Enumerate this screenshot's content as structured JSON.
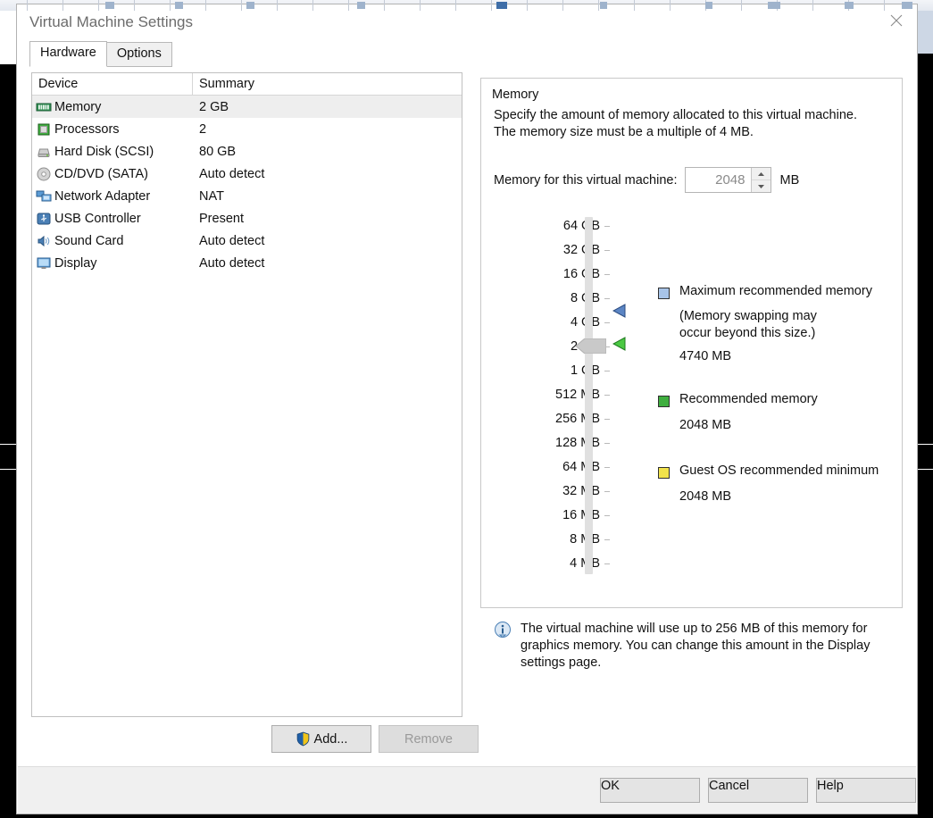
{
  "window": {
    "title": "Virtual Machine Settings",
    "close_icon": "close-icon"
  },
  "tabs": [
    {
      "label": "Hardware",
      "active": true
    },
    {
      "label": "Options",
      "active": false
    }
  ],
  "device_list": {
    "columns": [
      "Device",
      "Summary"
    ],
    "rows": [
      {
        "icon": "memory-icon",
        "device": "Memory",
        "summary": "2 GB",
        "selected": true
      },
      {
        "icon": "processor-icon",
        "device": "Processors",
        "summary": "2",
        "selected": false
      },
      {
        "icon": "hard-disk-icon",
        "device": "Hard Disk (SCSI)",
        "summary": "80 GB",
        "selected": false
      },
      {
        "icon": "cd-dvd-icon",
        "device": "CD/DVD (SATA)",
        "summary": "Auto detect",
        "selected": false
      },
      {
        "icon": "network-adapter-icon",
        "device": "Network Adapter",
        "summary": "NAT",
        "selected": false
      },
      {
        "icon": "usb-controller-icon",
        "device": "USB Controller",
        "summary": "Present",
        "selected": false
      },
      {
        "icon": "sound-card-icon",
        "device": "Sound Card",
        "summary": "Auto detect",
        "selected": false
      },
      {
        "icon": "display-icon",
        "device": "Display",
        "summary": "Auto detect",
        "selected": false
      }
    ],
    "add_button": "Add...",
    "remove_button": "Remove",
    "add_icon": "shield-icon"
  },
  "memory_panel": {
    "group_title": "Memory",
    "description": "Specify the amount of memory allocated to this virtual machine. The memory size must be a multiple of 4 MB.",
    "field_label": "Memory for this virtual machine:",
    "value": "2048",
    "unit": "MB",
    "scale_labels": [
      "64 GB",
      "32 GB",
      "16 GB",
      "8 GB",
      "4 GB",
      "2 GB",
      "1 GB",
      "512 MB",
      "256 MB",
      "128 MB",
      "64 MB",
      "32 MB",
      "16 MB",
      "8 MB",
      "4 MB"
    ],
    "slider_position_label": "2 GB",
    "markers": [
      {
        "name": "maximum-recommended-marker",
        "color": "#4a6fa5",
        "label": "Maximum recommended memory"
      },
      {
        "name": "recommended-marker",
        "color": "#3fae3f",
        "label": "Recommended memory"
      }
    ],
    "legend": [
      {
        "swatch_color": "#a8c4e8",
        "title": "Maximum recommended memory",
        "note": "(Memory swapping may occur beyond this size.)",
        "value": "4740 MB"
      },
      {
        "swatch_color": "#3fae3f",
        "title": "Recommended memory",
        "note": "",
        "value": "2048 MB"
      },
      {
        "swatch_color": "#f2e34c",
        "title": "Guest OS recommended minimum",
        "note": "",
        "value": "2048 MB"
      }
    ],
    "info_icon": "info-icon",
    "info_text": "The virtual machine will use up to 256 MB of this memory for graphics memory. You can change this amount in the Display settings page."
  },
  "footer": {
    "ok": "OK",
    "cancel": "Cancel",
    "help": "Help"
  }
}
